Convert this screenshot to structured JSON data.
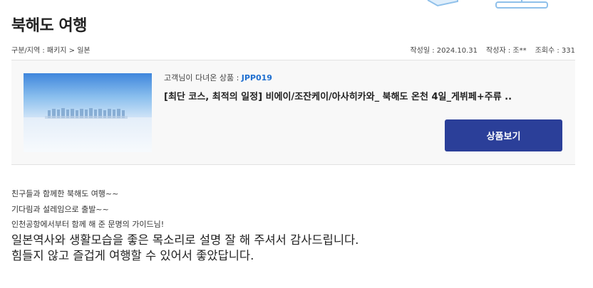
{
  "page": {
    "title": "북해도 여행"
  },
  "meta": {
    "category": "구분/지역 : 패키지 > 일본",
    "date": "작성일 : 2024.10.31",
    "author": "작성자 : 조**",
    "views": "조회수 : 331"
  },
  "product": {
    "code_label": "고객님이 다녀온 상품 : ",
    "code": "JPP019",
    "name": "[최단 코스, 최적의 일정] 비에이/조잔케이/아사히카와_ 북해도 온천 4일_게뷔페+주류 ..",
    "view_button": "상품보기",
    "thumb_icon": "snow-landscape-image"
  },
  "content": {
    "lines_small": [
      "친구들과 함께한 북해도 여행~~",
      "기다림과 설레임으로 출발~~",
      "인천공항에서부터 함께 해 준 문명의 가이드님!"
    ],
    "lines_large": [
      "일본역사와 생활모습을 좋은 목소리로 설명 잘 해 주셔서 감사드립니다.",
      "힘들지 않고 즐겁게 여행할 수 있어서 좋았답니다."
    ]
  },
  "colors": {
    "accent": "#2b3f99",
    "code": "#1f6fd0",
    "box_bg": "#f8f8f8"
  }
}
